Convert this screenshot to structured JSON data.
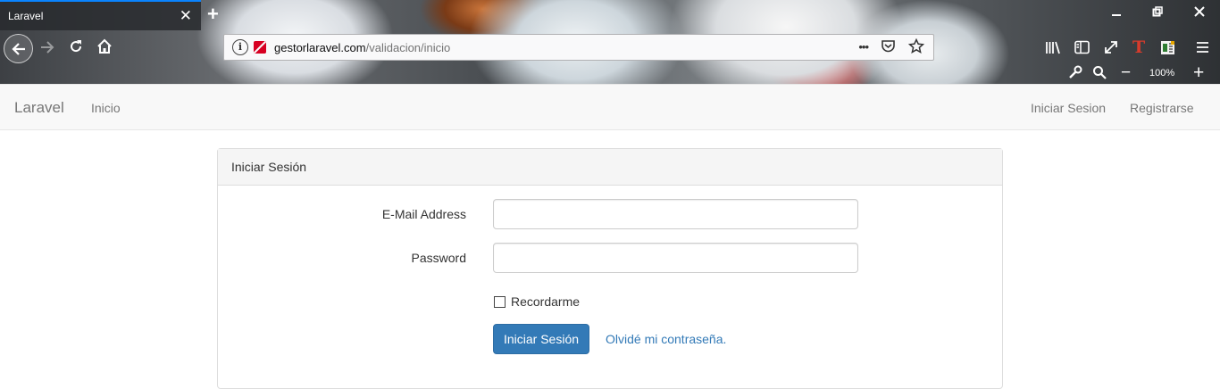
{
  "browser": {
    "tab_title": "Laravel",
    "tab_close": "✕",
    "new_tab": "+",
    "url_host": "gestorlaravel.com",
    "url_path": "/validacion/inicio",
    "url_info": "i",
    "url_more": "•••",
    "zoom_level": "100%",
    "zoom_out": "−",
    "zoom_in": "+",
    "icons": [
      "back-icon",
      "forward-icon",
      "reload-icon",
      "home-icon",
      "info-icon",
      "insecure-lock-icon",
      "page-actions-icon",
      "pocket-icon",
      "bookmark-star-icon",
      "library-icon",
      "sidebar-icon",
      "fullscreen-icon",
      "extension-t-icon",
      "extension-reader-icon",
      "menu-icon",
      "tools-icon",
      "search-icon"
    ]
  },
  "navbar": {
    "brand": "Laravel",
    "home_link": "Inicio",
    "login_link": "Iniciar Sesion",
    "register_link": "Registrarse"
  },
  "panel": {
    "heading": "Iniciar Sesión",
    "email_label": "E-Mail Address",
    "email_value": "",
    "password_label": "Password",
    "password_value": "",
    "remember_label": "Recordarme",
    "remember_checked": false,
    "submit_label": "Iniciar Sesión",
    "forgot_label": "Olvidé mi contraseña."
  },
  "colors": {
    "primary": "#337ab7",
    "navbar_bg": "#f8f8f8",
    "panel_heading_bg": "#f5f5f5"
  }
}
